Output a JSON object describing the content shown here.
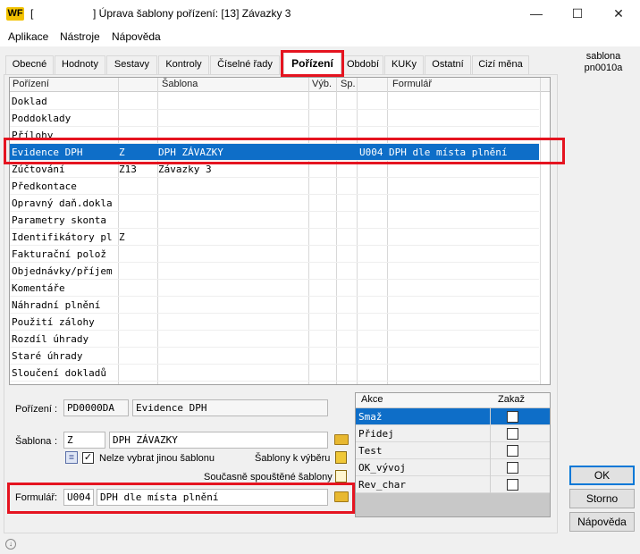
{
  "window": {
    "logo": "WF",
    "title": "[                    ] Úprava šablony pořízení: [13] Závazky 3",
    "min": "—",
    "max": "☐",
    "close": "✕"
  },
  "menu": [
    "Aplikace",
    "Nástroje",
    "Nápověda"
  ],
  "tabs": [
    "Obecné",
    "Hodnoty",
    "Sestavy",
    "Kontroly",
    "Číselné řady",
    "Pořízení",
    "Období",
    "KUKy",
    "Ostatní",
    "Cizí měna"
  ],
  "side": {
    "line1": "sablona",
    "line2": "pn0010a"
  },
  "grid": {
    "headers": [
      "Pořízení",
      "",
      "Šablona",
      "Výb.",
      "Sp.",
      "",
      "Formulář"
    ],
    "rows": [
      {
        "name": "Doklad",
        "z": "",
        "tpl": "",
        "code": "",
        "form": ""
      },
      {
        "name": "Poddoklady",
        "z": "",
        "tpl": "",
        "code": "",
        "form": ""
      },
      {
        "name": "Přílohy",
        "z": "",
        "tpl": "",
        "code": "",
        "form": ""
      },
      {
        "name": "Evidence DPH",
        "z": "Z",
        "tpl": "DPH ZÁVAZKY",
        "code": "U004",
        "form": "DPH dle místa plnění"
      },
      {
        "name": "Zúčtování",
        "z": "Z13",
        "tpl": "Závazky 3",
        "code": "",
        "form": ""
      },
      {
        "name": "Předkontace",
        "z": "",
        "tpl": "",
        "code": "",
        "form": ""
      },
      {
        "name": "Opravný daň.dokla",
        "z": "",
        "tpl": "",
        "code": "",
        "form": ""
      },
      {
        "name": "Parametry skonta",
        "z": "",
        "tpl": "",
        "code": "",
        "form": ""
      },
      {
        "name": "Identifikátory pl",
        "z": "Z",
        "tpl": "",
        "code": "",
        "form": ""
      },
      {
        "name": "Fakturační polož",
        "z": "",
        "tpl": "",
        "code": "",
        "form": ""
      },
      {
        "name": "Objednávky/příjem",
        "z": "",
        "tpl": "",
        "code": "",
        "form": ""
      },
      {
        "name": "Komentáře",
        "z": "",
        "tpl": "",
        "code": "",
        "form": ""
      },
      {
        "name": "Náhradní plnění",
        "z": "",
        "tpl": "",
        "code": "",
        "form": ""
      },
      {
        "name": "Použití zálohy",
        "z": "",
        "tpl": "",
        "code": "",
        "form": ""
      },
      {
        "name": "Rozdíl úhrady",
        "z": "",
        "tpl": "",
        "code": "",
        "form": ""
      },
      {
        "name": "Staré úhrady",
        "z": "",
        "tpl": "",
        "code": "",
        "form": ""
      },
      {
        "name": "Sloučení dokladů",
        "z": "",
        "tpl": "",
        "code": "",
        "form": ""
      }
    ]
  },
  "detail": {
    "porizeni_label": "Pořízení",
    "porizeni_code": "PD0000DA",
    "porizeni_name": "Evidence DPH",
    "sablona_label": "Šablona",
    "sablona_code": "Z",
    "sablona_name": "DPH ZÁVAZKY",
    "nelze_label": "Nelze vybrat jinou šablonu",
    "sablony_k_vyberu": "Šablony k výběru",
    "soucasne_label": "Současně spouštěné šablony",
    "formular_label": "Formulář",
    "formular_code": "U004",
    "formular_name": "DPH dle místa plnění"
  },
  "akce": {
    "col1": "Akce",
    "col2": "Zakaž",
    "rows": [
      "Smaž",
      "Přidej",
      "Test",
      "OK_vývoj",
      "Rev_char"
    ]
  },
  "buttons": {
    "ok": "OK",
    "storno": "Storno",
    "help": "Nápověda"
  },
  "colors": {
    "selection": "#0e6ec8",
    "highlight": "#e51420"
  }
}
